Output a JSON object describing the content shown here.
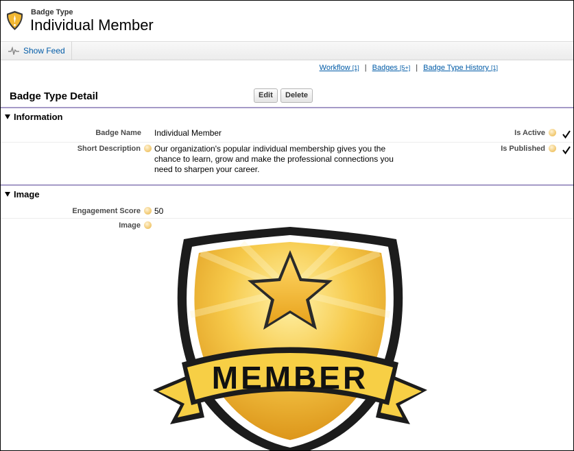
{
  "header": {
    "type_label": "Badge Type",
    "title": "Individual Member"
  },
  "feed": {
    "label": "Show Feed"
  },
  "related_links": [
    {
      "label": "Workflow",
      "count": "[1]"
    },
    {
      "label": "Badges",
      "count": "[5+]"
    },
    {
      "label": "Badge Type History",
      "count": "[1]"
    }
  ],
  "detail": {
    "title": "Badge Type Detail",
    "edit_label": "Edit",
    "delete_label": "Delete"
  },
  "information": {
    "heading": "Information",
    "badge_name_label": "Badge Name",
    "badge_name_value": "Individual Member",
    "short_description_label": "Short Description",
    "short_description_lines": [
      "Our organization's popular individual membership gives you the",
      "chance to learn, grow and make the professional connections you",
      "need to sharpen your career."
    ],
    "is_active_label": "Is Active",
    "is_active": true,
    "is_published_label": "Is Published",
    "is_published": true
  },
  "image_section": {
    "heading": "Image",
    "engagement_score_label": "Engagement Score",
    "engagement_score_value": "50",
    "image_label": "Image",
    "badge_text": "MEMBER"
  },
  "colors": {
    "link": "#015ba7",
    "section_rule": "#a59ac7",
    "badge_gold": "#f2b731",
    "banner": "#f7cf45"
  },
  "icons": {
    "feed": "pulse-icon",
    "check": "checkmark-icon",
    "help": "help-bubble-icon",
    "badge": "shield-badge-icon"
  }
}
